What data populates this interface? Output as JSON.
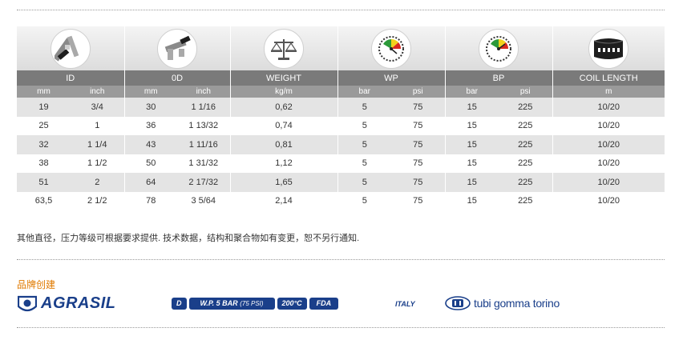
{
  "table": {
    "headers": [
      "ID",
      "0D",
      "WEIGHT",
      "WP",
      "BP",
      "COIL LENGTH"
    ],
    "units": [
      "mm",
      "inch",
      "mm",
      "inch",
      "kg/m",
      "bar",
      "psi",
      "bar",
      "psi",
      "m"
    ],
    "icons": [
      "caliper-icon",
      "caliper-icon",
      "scale-icon",
      "pressure-gauge-icon",
      "pressure-gauge-icon",
      "coiled-hose-icon"
    ],
    "rows": [
      [
        "19",
        "3/4",
        "30",
        "1 1/16",
        "0,62",
        "5",
        "75",
        "15",
        "225",
        "10/20"
      ],
      [
        "25",
        "1",
        "36",
        "1 13/32",
        "0,74",
        "5",
        "75",
        "15",
        "225",
        "10/20"
      ],
      [
        "32",
        "1 1/4",
        "43",
        "1 11/16",
        "0,81",
        "5",
        "75",
        "15",
        "225",
        "10/20"
      ],
      [
        "38",
        "1 1/2",
        "50",
        "1 31/32",
        "1,12",
        "5",
        "75",
        "15",
        "225",
        "10/20"
      ],
      [
        "51",
        "2",
        "64",
        "2 17/32",
        "1,65",
        "5",
        "75",
        "15",
        "225",
        "10/20"
      ],
      [
        "63,5",
        "2 1/2",
        "78",
        "3 5/64",
        "2,14",
        "5",
        "75",
        "15",
        "225",
        "10/20"
      ]
    ]
  },
  "note": "其他直径，压力等级可根据要求提供. 技术数据，结构和聚合物如有变更，恕不另行通知.",
  "brand": {
    "label": "品牌创建",
    "name": "AGRASIL",
    "badges": {
      "d": "D",
      "wp_main": "W.P. 5 BAR",
      "wp_sub": "(75 PSI)",
      "temp": "200°C",
      "fda": "FDA"
    },
    "origin": "ITALY",
    "maker": "tubi gomma torino"
  },
  "colors": {
    "header_bg": "#7a7a7a",
    "unit_bg": "#9a9a9a",
    "row_alt": "#e4e4e4",
    "brand_blue": "#1a3f8a",
    "label_orange": "#e07a00"
  }
}
